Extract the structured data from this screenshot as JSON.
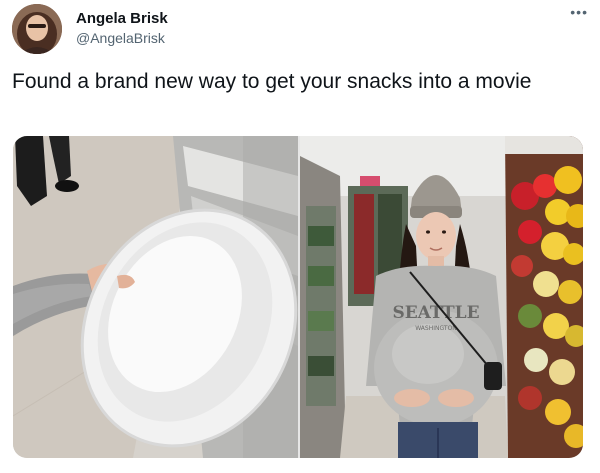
{
  "author": {
    "name": "Angela Brisk",
    "handle": "@AngelaBrisk"
  },
  "more_icon": "more-horizontal-icon",
  "tweet": {
    "text": "Found a brand new way to get your snacks into a movie"
  },
  "media": {
    "photo_right": {
      "shirt_print": "SEATTLE",
      "shirt_subprint": "WASHINGTON"
    }
  },
  "colors": {
    "text_primary": "#0f1419",
    "text_secondary": "#536471"
  }
}
